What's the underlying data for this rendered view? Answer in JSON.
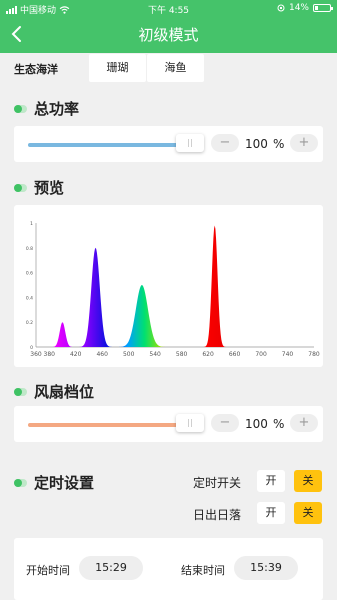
{
  "status_bar": {
    "carrier": "中国移动",
    "time": "下午 4:55",
    "battery": "14%"
  },
  "header": {
    "title": "初级模式"
  },
  "eco": {
    "label": "生态海洋",
    "tabs": [
      "珊瑚",
      "海鱼"
    ]
  },
  "power": {
    "title": "总功率",
    "handle": "||",
    "minus": "−",
    "plus": "+",
    "value": "100",
    "unit": "%",
    "level_percent": 100,
    "track_color": "#7ab8e0"
  },
  "preview": {
    "title": "预览",
    "chart_data": {
      "type": "area",
      "x_ticks": [
        "360",
        "380",
        "420",
        "460",
        "500",
        "540",
        "580",
        "620",
        "660",
        "700",
        "740",
        "780"
      ],
      "y_ticks": [
        "0",
        "0.2",
        "0.4",
        "0.6",
        "0.8",
        "1"
      ],
      "xlim": [
        360,
        780
      ],
      "ylim": [
        0,
        1
      ],
      "peaks": [
        {
          "x": 400,
          "y": 0.2
        },
        {
          "x": 450,
          "y": 0.8
        },
        {
          "x": 520,
          "y": 0.5
        },
        {
          "x": 630,
          "y": 0.98
        }
      ]
    }
  },
  "fan": {
    "title": "风扇档位",
    "handle": "||",
    "minus": "−",
    "plus": "+",
    "value": "100",
    "unit": "%",
    "level_percent": 100,
    "track_color": "#f4a882"
  },
  "timer": {
    "title": "定时设置",
    "timer_switch_label": "定时开关",
    "sunrise_label": "日出日落",
    "on": "开",
    "off": "关",
    "start_label": "开始时间",
    "start_time": "15:29",
    "end_label": "结束时间",
    "end_time": "15:39"
  }
}
